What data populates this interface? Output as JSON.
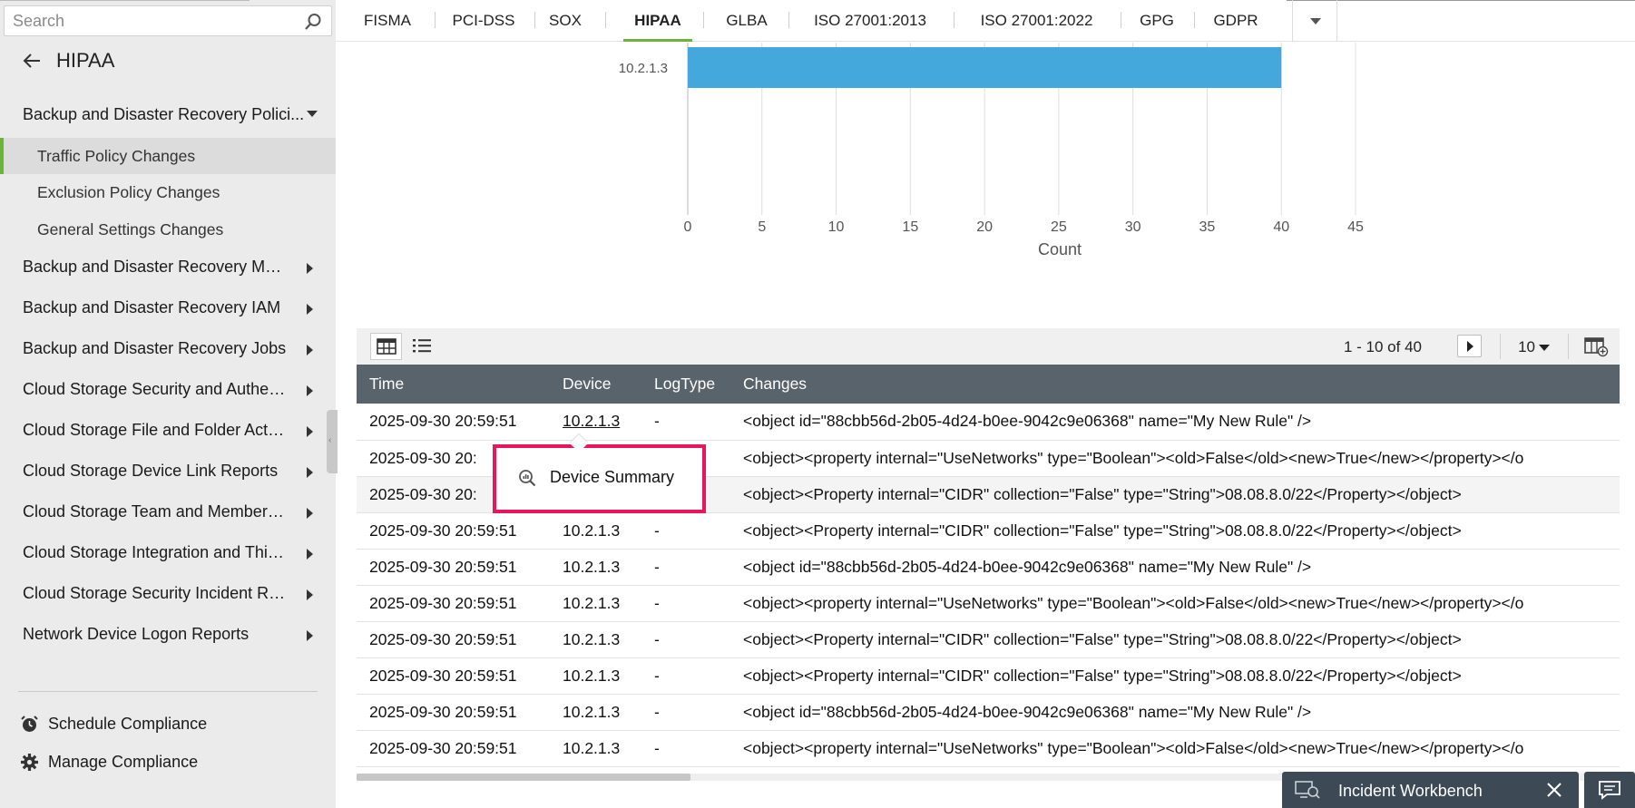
{
  "search": {
    "placeholder": "Search"
  },
  "sidebar": {
    "back_title": "HIPAA",
    "expanded_group": "Backup and Disaster Recovery Polici...",
    "sub_items": [
      "Traffic Policy Changes",
      "Exclusion Policy Changes",
      "General Settings Changes"
    ],
    "active_sub_index": 0,
    "items": [
      "Backup and Disaster Recovery Mal...",
      "Backup and Disaster Recovery IAM",
      "Backup and Disaster Recovery Jobs",
      "Cloud Storage Security and Authen...",
      "Cloud Storage File and Folder Activi...",
      "Cloud Storage Device Link Reports",
      "Cloud Storage Team and Member M...",
      "Cloud Storage Integration and Third ...",
      "Cloud Storage Security Incident Rep...",
      "Network Device Logon Reports"
    ],
    "footer": {
      "schedule": "Schedule Compliance",
      "manage": "Manage Compliance"
    }
  },
  "tabs": {
    "items": [
      "FISMA",
      "PCI-DSS",
      "SOX",
      "HIPAA",
      "GLBA",
      "ISO 27001:2013",
      "ISO 27001:2022",
      "GPG",
      "GDPR"
    ],
    "active": "HIPAA"
  },
  "chart_data": {
    "type": "bar",
    "orientation": "horizontal",
    "categories": [
      "10.2.1.3"
    ],
    "values": [
      40
    ],
    "xlabel": "Count",
    "ylabel": "",
    "xlim": [
      0,
      45
    ],
    "ticks": [
      0,
      5,
      10,
      15,
      20,
      25,
      30,
      35,
      40,
      45
    ],
    "grid": true,
    "bar_color": "#45a8dc"
  },
  "toolbar": {
    "pager_text": "1 - 10 of 40",
    "page_size": "10"
  },
  "table": {
    "columns": [
      "Time",
      "Device",
      "LogType",
      "Changes"
    ],
    "rows": [
      [
        "2025-09-30 20:59:51",
        "10.2.1.3",
        "-",
        "<object id=\"88cbb56d-2b05-4d24-b0ee-9042c9e06368\" name=\"My New Rule\" />"
      ],
      [
        "2025-09-30 20:",
        "",
        "",
        "<object><property internal=\"UseNetworks\" type=\"Boolean\"><old>False</old><new>True</new></property></o"
      ],
      [
        "2025-09-30 20:",
        "",
        "",
        "<object><Property internal=\"CIDR\" collection=\"False\" type=\"String\">08.08.8.0/22</Property></object>"
      ],
      [
        "2025-09-30 20:59:51",
        "10.2.1.3",
        "-",
        "<object><Property internal=\"CIDR\" collection=\"False\" type=\"String\">08.08.8.0/22</Property></object>"
      ],
      [
        "2025-09-30 20:59:51",
        "10.2.1.3",
        "-",
        "<object id=\"88cbb56d-2b05-4d24-b0ee-9042c9e06368\" name=\"My New Rule\" />"
      ],
      [
        "2025-09-30 20:59:51",
        "10.2.1.3",
        "-",
        "<object><property internal=\"UseNetworks\" type=\"Boolean\"><old>False</old><new>True</new></property></o"
      ],
      [
        "2025-09-30 20:59:51",
        "10.2.1.3",
        "-",
        "<object><Property internal=\"CIDR\" collection=\"False\" type=\"String\">08.08.8.0/22</Property></object>"
      ],
      [
        "2025-09-30 20:59:51",
        "10.2.1.3",
        "-",
        "<object><Property internal=\"CIDR\" collection=\"False\" type=\"String\">08.08.8.0/22</Property></object>"
      ],
      [
        "2025-09-30 20:59:51",
        "10.2.1.3",
        "-",
        "<object id=\"88cbb56d-2b05-4d24-b0ee-9042c9e06368\" name=\"My New Rule\" />"
      ],
      [
        "2025-09-30 20:59:51",
        "10.2.1.3",
        "-",
        "<object><property internal=\"UseNetworks\" type=\"Boolean\"><old>False</old><new>True</new></property></o"
      ]
    ]
  },
  "popup": {
    "label": "Device Summary"
  },
  "incident": {
    "label": "Incident Workbench"
  },
  "colors": {
    "accent": "#6bb33a",
    "header_bg": "#59636b",
    "popup_border": "#e8175d",
    "bar": "#45a8dc"
  }
}
